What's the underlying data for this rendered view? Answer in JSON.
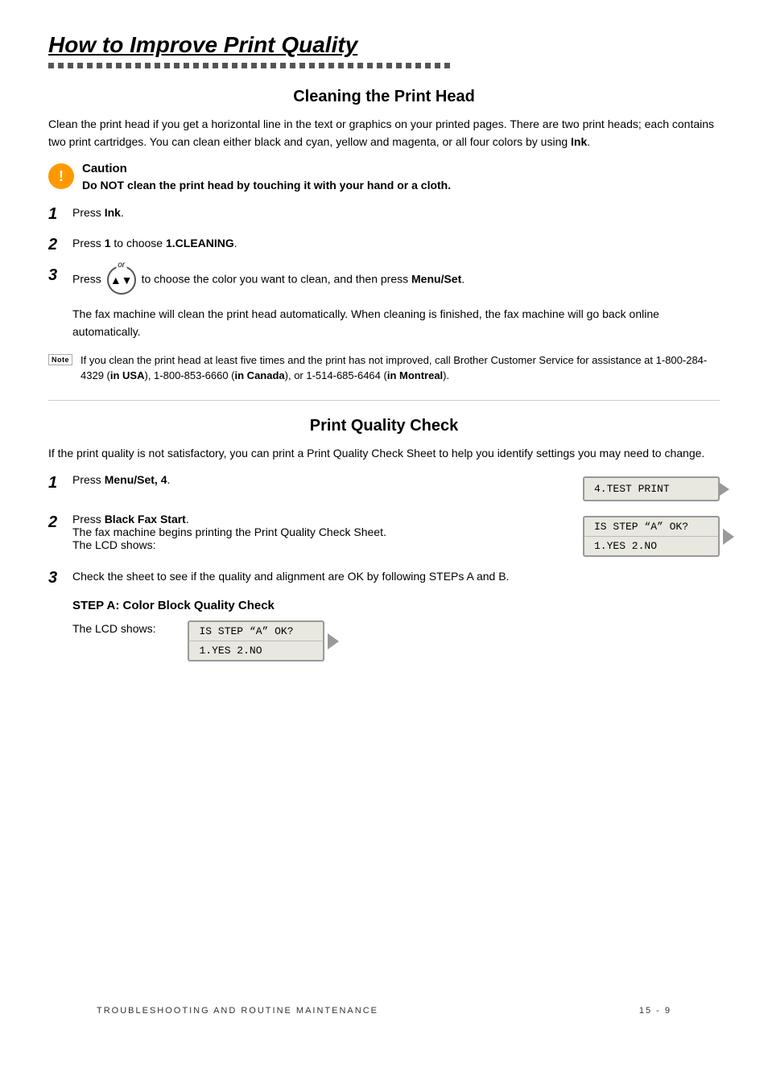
{
  "title": "How to Improve Print Quality",
  "section1": {
    "heading": "Cleaning the Print Head",
    "intro": "Clean the print head if you get a horizontal line in the text or graphics on your printed pages. There are two print heads; each contains two print cartridges. You can clean either black and cyan, yellow and magenta, or all four colors by using Ink.",
    "caution": {
      "title": "Caution",
      "body": "Do NOT clean the print head by touching it with your hand or a cloth."
    },
    "steps": [
      {
        "num": "1",
        "text_prefix": "Press ",
        "text_bold": "Ink",
        "text_suffix": "."
      },
      {
        "num": "2",
        "text_prefix": "Press ",
        "text_bold": "1",
        "text_middle": " to choose ",
        "text_code": "1.CLEANING",
        "text_suffix": "."
      },
      {
        "num": "3",
        "text_prefix": "Press ",
        "text_middle": " to choose the color you want to clean, and then press ",
        "text_bold": "Menu/Set",
        "text_suffix": "."
      }
    ],
    "after_step3": "The fax machine will clean the print head automatically. When cleaning is finished, the fax machine will go back online automatically.",
    "note": "If you clean the print head at least five times and the print has not improved, call Brother Customer Service for assistance at 1-800-284-4329 (in USA), 1-800-853-6660 (in Canada), or 1-514-685-6464 (in Montreal)."
  },
  "section2": {
    "heading": "Print Quality Check",
    "intro": "If the print quality is not satisfactory, you can print a Print Quality Check Sheet to help you identify settings you may need to change.",
    "steps": [
      {
        "num": "1",
        "text_prefix": "Press ",
        "text_bold": "Menu/Set, 4",
        "text_suffix": ".",
        "lcd": {
          "type": "single",
          "line": "4.TEST PRINT"
        }
      },
      {
        "num": "2",
        "text_prefix_bold": "Black Fax Start",
        "text_prefix": "Press ",
        "text_suffix": ".",
        "sub_text": "The fax machine begins printing the Print Quality Check Sheet. The LCD shows:",
        "lcd": {
          "type": "double",
          "line1": "IS STEP “A” OK?",
          "line2": "1.YES 2.NO"
        }
      },
      {
        "num": "3",
        "text": "Check the sheet to see if the quality and alignment are OK by following STEPs A and B."
      }
    ],
    "substep_a": {
      "heading": "STEP A: Color Block Quality Check",
      "lcd_label": "The LCD shows:",
      "lcd": {
        "line1": "IS STEP “A” OK?",
        "line2": "1.YES 2.NO"
      }
    }
  },
  "footer": {
    "left": "TROUBLESHOOTING AND ROUTINE MAINTENANCE",
    "right": "15 - 9"
  }
}
